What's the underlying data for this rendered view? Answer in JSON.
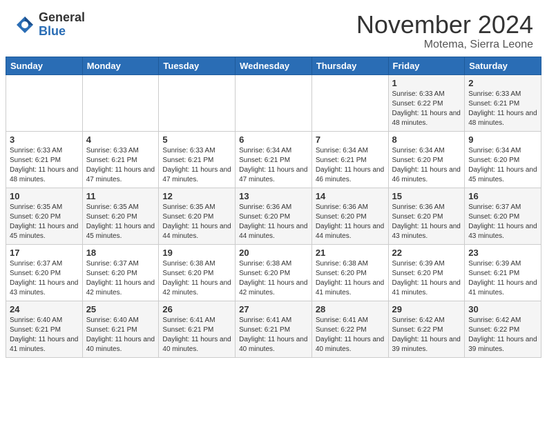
{
  "header": {
    "logo_general": "General",
    "logo_blue": "Blue",
    "month_title": "November 2024",
    "location": "Motema, Sierra Leone"
  },
  "days_of_week": [
    "Sunday",
    "Monday",
    "Tuesday",
    "Wednesday",
    "Thursday",
    "Friday",
    "Saturday"
  ],
  "weeks": [
    [
      {
        "day": "",
        "info": ""
      },
      {
        "day": "",
        "info": ""
      },
      {
        "day": "",
        "info": ""
      },
      {
        "day": "",
        "info": ""
      },
      {
        "day": "",
        "info": ""
      },
      {
        "day": "1",
        "info": "Sunrise: 6:33 AM\nSunset: 6:22 PM\nDaylight: 11 hours and 48 minutes."
      },
      {
        "day": "2",
        "info": "Sunrise: 6:33 AM\nSunset: 6:21 PM\nDaylight: 11 hours and 48 minutes."
      }
    ],
    [
      {
        "day": "3",
        "info": "Sunrise: 6:33 AM\nSunset: 6:21 PM\nDaylight: 11 hours and 48 minutes."
      },
      {
        "day": "4",
        "info": "Sunrise: 6:33 AM\nSunset: 6:21 PM\nDaylight: 11 hours and 47 minutes."
      },
      {
        "day": "5",
        "info": "Sunrise: 6:33 AM\nSunset: 6:21 PM\nDaylight: 11 hours and 47 minutes."
      },
      {
        "day": "6",
        "info": "Sunrise: 6:34 AM\nSunset: 6:21 PM\nDaylight: 11 hours and 47 minutes."
      },
      {
        "day": "7",
        "info": "Sunrise: 6:34 AM\nSunset: 6:21 PM\nDaylight: 11 hours and 46 minutes."
      },
      {
        "day": "8",
        "info": "Sunrise: 6:34 AM\nSunset: 6:20 PM\nDaylight: 11 hours and 46 minutes."
      },
      {
        "day": "9",
        "info": "Sunrise: 6:34 AM\nSunset: 6:20 PM\nDaylight: 11 hours and 45 minutes."
      }
    ],
    [
      {
        "day": "10",
        "info": "Sunrise: 6:35 AM\nSunset: 6:20 PM\nDaylight: 11 hours and 45 minutes."
      },
      {
        "day": "11",
        "info": "Sunrise: 6:35 AM\nSunset: 6:20 PM\nDaylight: 11 hours and 45 minutes."
      },
      {
        "day": "12",
        "info": "Sunrise: 6:35 AM\nSunset: 6:20 PM\nDaylight: 11 hours and 44 minutes."
      },
      {
        "day": "13",
        "info": "Sunrise: 6:36 AM\nSunset: 6:20 PM\nDaylight: 11 hours and 44 minutes."
      },
      {
        "day": "14",
        "info": "Sunrise: 6:36 AM\nSunset: 6:20 PM\nDaylight: 11 hours and 44 minutes."
      },
      {
        "day": "15",
        "info": "Sunrise: 6:36 AM\nSunset: 6:20 PM\nDaylight: 11 hours and 43 minutes."
      },
      {
        "day": "16",
        "info": "Sunrise: 6:37 AM\nSunset: 6:20 PM\nDaylight: 11 hours and 43 minutes."
      }
    ],
    [
      {
        "day": "17",
        "info": "Sunrise: 6:37 AM\nSunset: 6:20 PM\nDaylight: 11 hours and 43 minutes."
      },
      {
        "day": "18",
        "info": "Sunrise: 6:37 AM\nSunset: 6:20 PM\nDaylight: 11 hours and 42 minutes."
      },
      {
        "day": "19",
        "info": "Sunrise: 6:38 AM\nSunset: 6:20 PM\nDaylight: 11 hours and 42 minutes."
      },
      {
        "day": "20",
        "info": "Sunrise: 6:38 AM\nSunset: 6:20 PM\nDaylight: 11 hours and 42 minutes."
      },
      {
        "day": "21",
        "info": "Sunrise: 6:38 AM\nSunset: 6:20 PM\nDaylight: 11 hours and 41 minutes."
      },
      {
        "day": "22",
        "info": "Sunrise: 6:39 AM\nSunset: 6:20 PM\nDaylight: 11 hours and 41 minutes."
      },
      {
        "day": "23",
        "info": "Sunrise: 6:39 AM\nSunset: 6:21 PM\nDaylight: 11 hours and 41 minutes."
      }
    ],
    [
      {
        "day": "24",
        "info": "Sunrise: 6:40 AM\nSunset: 6:21 PM\nDaylight: 11 hours and 41 minutes."
      },
      {
        "day": "25",
        "info": "Sunrise: 6:40 AM\nSunset: 6:21 PM\nDaylight: 11 hours and 40 minutes."
      },
      {
        "day": "26",
        "info": "Sunrise: 6:41 AM\nSunset: 6:21 PM\nDaylight: 11 hours and 40 minutes."
      },
      {
        "day": "27",
        "info": "Sunrise: 6:41 AM\nSunset: 6:21 PM\nDaylight: 11 hours and 40 minutes."
      },
      {
        "day": "28",
        "info": "Sunrise: 6:41 AM\nSunset: 6:22 PM\nDaylight: 11 hours and 40 minutes."
      },
      {
        "day": "29",
        "info": "Sunrise: 6:42 AM\nSunset: 6:22 PM\nDaylight: 11 hours and 39 minutes."
      },
      {
        "day": "30",
        "info": "Sunrise: 6:42 AM\nSunset: 6:22 PM\nDaylight: 11 hours and 39 minutes."
      }
    ]
  ]
}
